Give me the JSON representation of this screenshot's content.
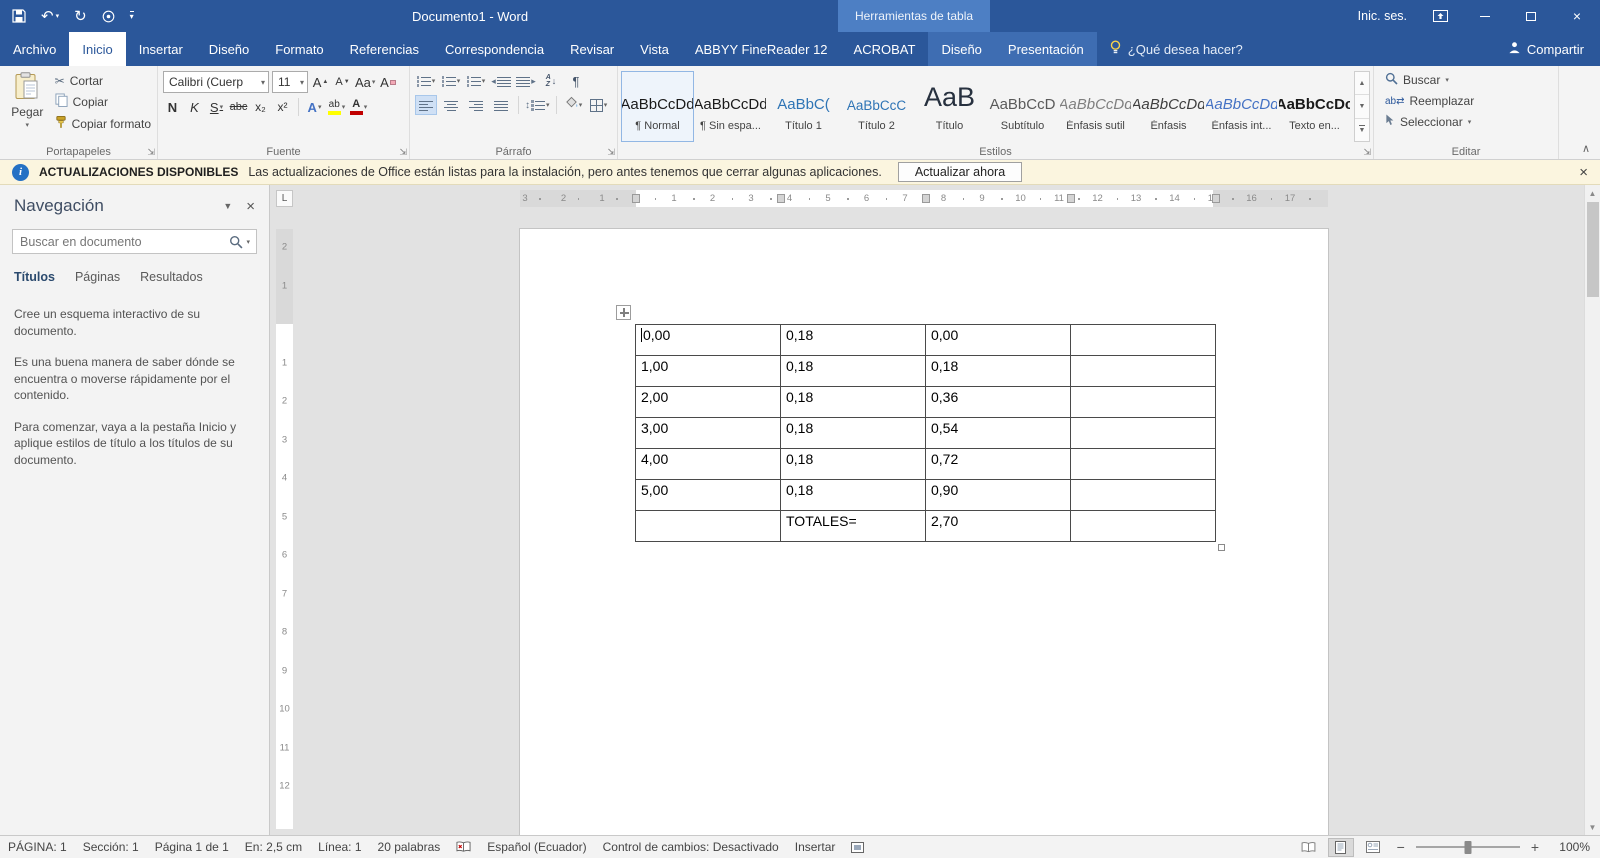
{
  "title_bar": {
    "title": "Documento1  -  Word",
    "contextual_group": "Herramientas de tabla",
    "sign_in": "Inic. ses."
  },
  "ribbon_tabs": {
    "file": "Archivo",
    "main": [
      "Inicio",
      "Insertar",
      "Diseño",
      "Formato",
      "Referencias",
      "Correspondencia",
      "Revisar",
      "Vista",
      "ABBYY FineReader 12",
      "ACROBAT"
    ],
    "contextual": [
      "Diseño",
      "Presentación"
    ],
    "tell_me": "¿Qué desea hacer?",
    "share": "Compartir"
  },
  "ribbon": {
    "clipboard": {
      "label": "Portapapeles",
      "paste": "Pegar",
      "cut": "Cortar",
      "copy": "Copiar",
      "format_painter": "Copiar formato"
    },
    "font": {
      "label": "Fuente",
      "family": "Calibri (Cuerp",
      "size": "11",
      "bold": "N",
      "italic": "K",
      "underline": "S",
      "strikethrough": "abc",
      "subscript": "x₂",
      "superscript": "x²",
      "effects": "A",
      "highlight": "ab",
      "color": "A",
      "grow": "A",
      "shrink": "A",
      "case": "Aa",
      "clear": "A"
    },
    "paragraph": {
      "label": "Párrafo",
      "pilcrow": "¶",
      "sort_a": "A",
      "sort_z": "Z"
    },
    "styles": {
      "label": "Estilos",
      "items": [
        {
          "preview": "AaBbCcDd",
          "name": "¶ Normal"
        },
        {
          "preview": "AaBbCcDd",
          "name": "¶ Sin espa..."
        },
        {
          "preview": "AaBbC(",
          "name": "Título 1"
        },
        {
          "preview": "AaBbCcC",
          "name": "Título 2"
        },
        {
          "preview": "AaB",
          "name": "Título"
        },
        {
          "preview": "AaBbCcD",
          "name": "Subtítulo"
        },
        {
          "preview": "AaBbCcDd",
          "name": "Énfasis sutil"
        },
        {
          "preview": "AaBbCcDd",
          "name": "Énfasis"
        },
        {
          "preview": "AaBbCcDd",
          "name": "Énfasis int..."
        },
        {
          "preview": "AaBbCcDc",
          "name": "Texto en..."
        }
      ]
    },
    "editing": {
      "label": "Editar",
      "find": "Buscar",
      "replace": "Reemplazar",
      "select": "Seleccionar"
    }
  },
  "notification": {
    "badge": "ACTUALIZACIONES DISPONIBLES",
    "message": "Las actualizaciones de Office están listas para la instalación, pero antes tenemos que cerrar algunas aplicaciones.",
    "button": "Actualizar ahora"
  },
  "nav_pane": {
    "title": "Navegación",
    "search_placeholder": "Buscar en documento",
    "tabs": [
      "Títulos",
      "Páginas",
      "Resultados"
    ],
    "body": [
      "Cree un esquema interactivo de su documento.",
      "Es una buena manera de saber dónde se encuentra o moverse rápidamente por el contenido.",
      "Para comenzar, vaya a la pestaña Inicio y aplique estilos de título a los títulos de su documento."
    ]
  },
  "ruler": {
    "tab_selector": "L",
    "h_margin": [
      "3",
      "2",
      "1"
    ],
    "h_main": [
      "1",
      "2",
      "3",
      "4",
      "5",
      "6",
      "7",
      "8",
      "9",
      "10",
      "11",
      "12",
      "13",
      "14"
    ],
    "h_right": [
      "15",
      "16",
      "17"
    ],
    "v_margin": [
      "2",
      "1"
    ],
    "v_main": [
      "1",
      "2",
      "3",
      "4",
      "5",
      "6",
      "7",
      "8",
      "9",
      "10",
      "11",
      "12"
    ]
  },
  "document": {
    "table": [
      [
        "0,00",
        "0,18",
        "0,00",
        ""
      ],
      [
        "1,00",
        "0,18",
        "0,18",
        ""
      ],
      [
        "2,00",
        "0,18",
        "0,36",
        ""
      ],
      [
        "3,00",
        "0,18",
        "0,54",
        ""
      ],
      [
        "4,00",
        "0,18",
        "0,72",
        ""
      ],
      [
        "5,00",
        "0,18",
        "0,90",
        ""
      ],
      [
        "",
        "TOTALES=",
        "2,70",
        ""
      ]
    ]
  },
  "status_bar": {
    "page": "PÁGINA: 1",
    "section": "Sección: 1",
    "page_of": "Página 1 de 1",
    "at": "En: 2,5 cm",
    "line": "Línea: 1",
    "words": "20 palabras",
    "language": "Español (Ecuador)",
    "track_changes": "Control de cambios: Desactivado",
    "insert_mode": "Insertar",
    "zoom_level": "100%"
  },
  "colors": {
    "accent": "#2b579a",
    "contextual_tab_bg": "#4d7fc4",
    "notification_bg": "#fbf5df",
    "highlight_indicator": "#ffff00",
    "font_color_indicator": "#c00000",
    "heading_blue": "#2e74b5"
  }
}
